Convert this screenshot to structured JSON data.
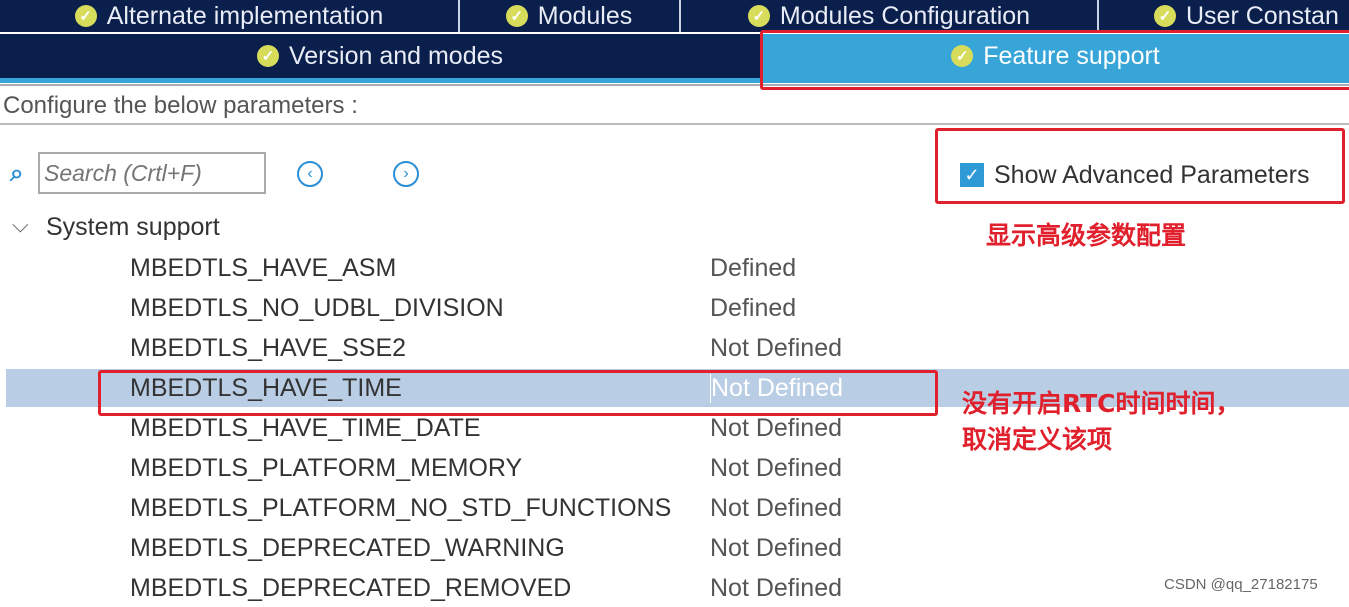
{
  "tabs_row1": [
    {
      "label": "Alternate implementation"
    },
    {
      "label": "Modules"
    },
    {
      "label": "Modules Configuration"
    },
    {
      "label": "User Constan"
    }
  ],
  "tabs_row2": [
    {
      "label": "Version and modes"
    },
    {
      "label": "Feature support",
      "active": true
    }
  ],
  "configure_label": "Configure the below parameters :",
  "search": {
    "placeholder": "Search (Crtl+F)"
  },
  "show_advanced": {
    "label": "Show Advanced Parameters",
    "checked": true
  },
  "group": {
    "label": "System support",
    "expanded": true
  },
  "params": [
    {
      "name": "MBEDTLS_HAVE_ASM",
      "value": "Defined"
    },
    {
      "name": "MBEDTLS_NO_UDBL_DIVISION",
      "value": "Defined"
    },
    {
      "name": "MBEDTLS_HAVE_SSE2",
      "value": "Not Defined"
    },
    {
      "name": "MBEDTLS_HAVE_TIME",
      "value": "Not Defined",
      "selected": true
    },
    {
      "name": "MBEDTLS_HAVE_TIME_DATE",
      "value": "Not Defined"
    },
    {
      "name": "MBEDTLS_PLATFORM_MEMORY",
      "value": "Not Defined"
    },
    {
      "name": "MBEDTLS_PLATFORM_NO_STD_FUNCTIONS",
      "value": "Not Defined"
    },
    {
      "name": "MBEDTLS_DEPRECATED_WARNING",
      "value": "Not Defined"
    },
    {
      "name": "MBEDTLS_DEPRECATED_REMOVED",
      "value": "Not Defined"
    }
  ],
  "annotations": {
    "advanced": "显示高级参数配置",
    "time_line1": "没有开启RTC时间时间，",
    "time_line2": "取消定义该项"
  },
  "watermark": "CSDN @qq_27182175",
  "colors": {
    "tab_bg": "#0b1f4d",
    "active_tab": "#38a5d8",
    "highlight": "#b9cde5",
    "annotation": "#e0202c"
  }
}
